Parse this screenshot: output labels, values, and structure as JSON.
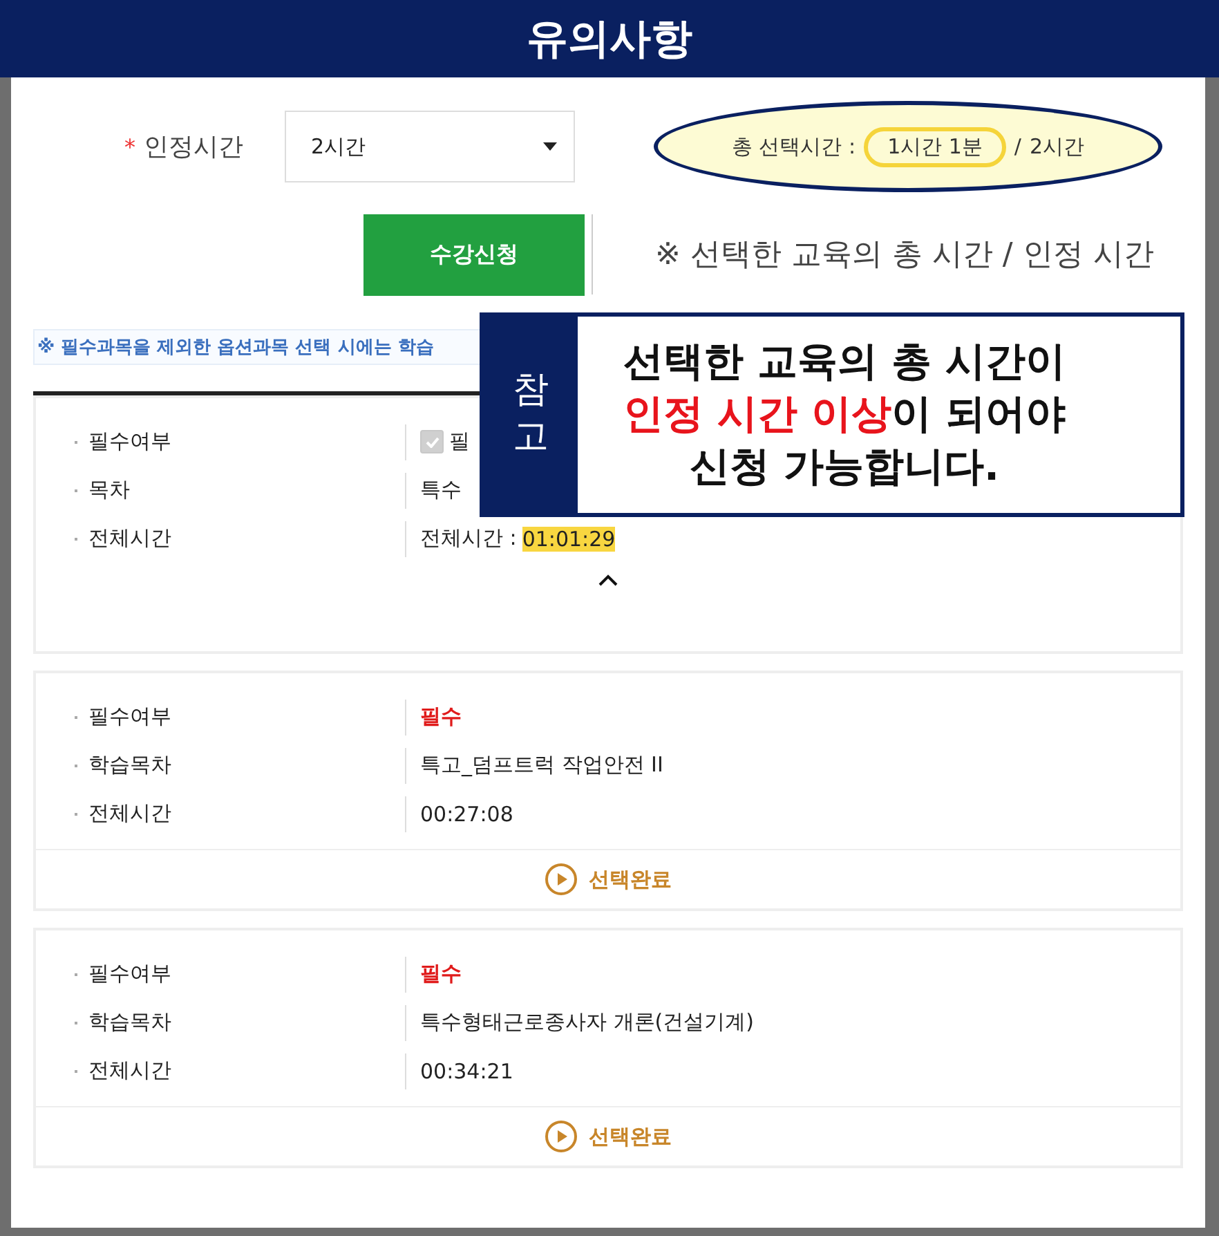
{
  "window": {
    "title": "유의사항"
  },
  "form": {
    "required_mark": "*",
    "label": "인정시간",
    "select": {
      "value": "2시간"
    },
    "summary": {
      "label": "총 선택시간 :",
      "selected": "1시간 1분",
      "separator": "/",
      "total": "2시간"
    },
    "apply_button": "수강신청",
    "note": "※ 선택한 교육의 총 시간 / 인정 시간"
  },
  "notice": "※ 필수과목을 제외한 옵션과목 선택 시에는 학습",
  "callout": {
    "tag": "참고",
    "lines": [
      "선택한 교육의 총 시간이",
      "**인정 시간 이상**이 되어야",
      "신청 가능합니다."
    ]
  },
  "cards": [
    {
      "expanded": true,
      "rows": [
        {
          "label": "필수여부",
          "kind": "check",
          "checked": true,
          "value": "필"
        },
        {
          "label": "목차",
          "kind": "text",
          "value": "특수"
        },
        {
          "label": "전체시간",
          "kind": "highlight",
          "value": "전체시간 :",
          "highlight": "01:01:29"
        }
      ]
    },
    {
      "expanded": false,
      "rows": [
        {
          "label": "필수여부",
          "kind": "required",
          "value": "필수"
        },
        {
          "label": "학습목차",
          "kind": "text",
          "value": "특고_덤프트럭 작업안전 II"
        },
        {
          "label": "전체시간",
          "kind": "text",
          "value": "00:27:08"
        }
      ],
      "action": "선택완료"
    },
    {
      "expanded": false,
      "rows": [
        {
          "label": "필수여부",
          "kind": "required",
          "value": "필수"
        },
        {
          "label": "학습목차",
          "kind": "text",
          "value": "특수형태근로종사자 개론(건설기계)"
        },
        {
          "label": "전체시간",
          "kind": "text",
          "value": "00:34:21"
        }
      ],
      "action": "선택완료"
    }
  ]
}
